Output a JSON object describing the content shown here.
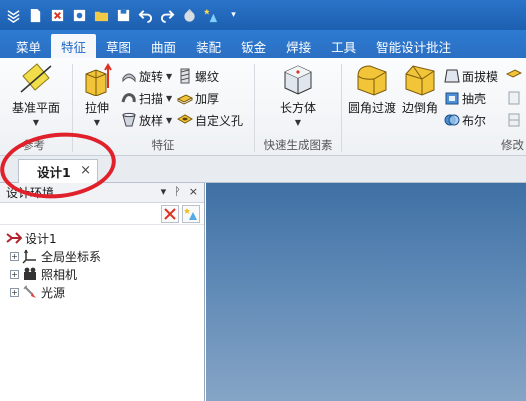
{
  "tabs": [
    {
      "label": "菜单",
      "active": false
    },
    {
      "label": "特征",
      "active": true
    },
    {
      "label": "草图",
      "active": false
    },
    {
      "label": "曲面",
      "active": false
    },
    {
      "label": "装配",
      "active": false
    },
    {
      "label": "钣金",
      "active": false
    },
    {
      "label": "焊接",
      "active": false
    },
    {
      "label": "工具",
      "active": false
    },
    {
      "label": "智能设计批注",
      "active": false
    }
  ],
  "ribbon": {
    "datum": {
      "button": "基准平面",
      "label": "参考"
    },
    "features": {
      "extrude": "拉伸",
      "revolve": "旋转",
      "sweep": "扫描",
      "loft": "放样",
      "thread": "螺纹",
      "thicken": "加厚",
      "custom_hole": "自定义孔",
      "label": "特征"
    },
    "quick": {
      "box": "长方体",
      "label": "快速生成图素"
    },
    "modify": {
      "fillet": "圆角过渡",
      "chamfer": "边倒角",
      "draft": "面拔模",
      "shell": "抽壳",
      "boolean": "布尔",
      "label": "修改"
    }
  },
  "document": {
    "tab_label": "设计1",
    "close_glyph": "×"
  },
  "panel": {
    "title": "设计环境",
    "controls": [
      "▾",
      "ᚹ",
      "×"
    ],
    "tree": {
      "root": "设计1",
      "items": [
        "全局坐标系",
        "照相机",
        "光源"
      ]
    }
  },
  "colors": {
    "ribbon_blue": "#2b6fc2",
    "annotation_red": "#e0202a",
    "viewport_top": "#3f70a4",
    "viewport_bottom": "#86a5c6"
  }
}
